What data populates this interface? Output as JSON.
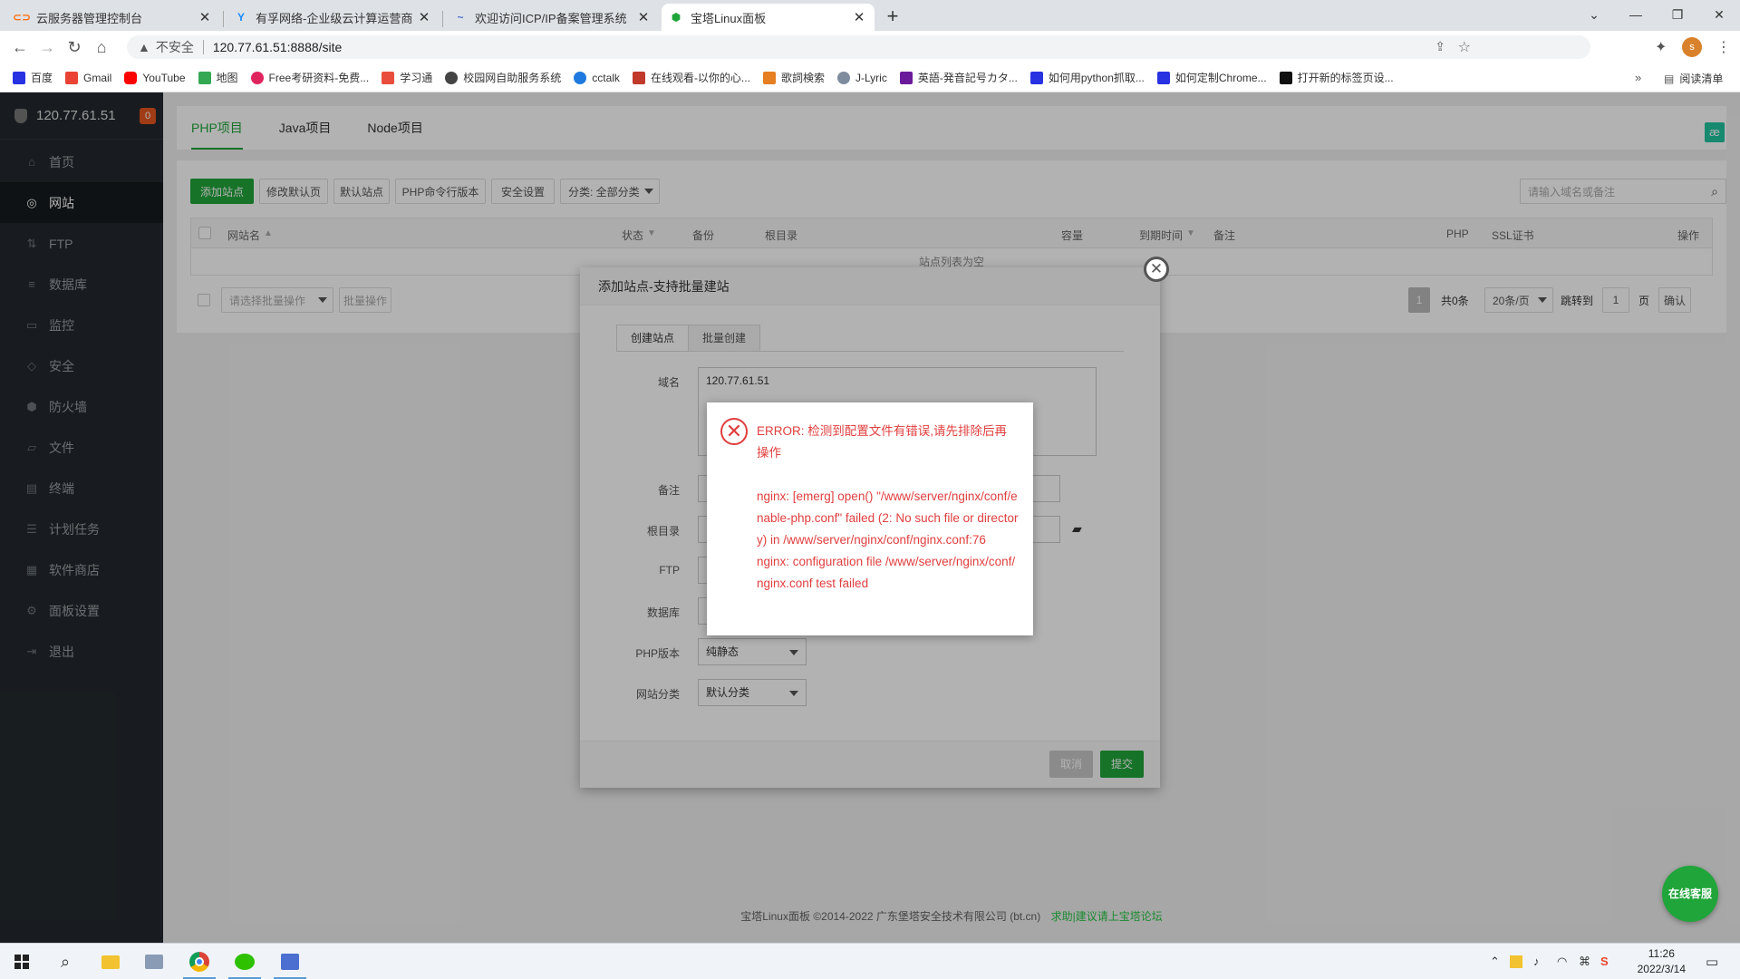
{
  "browser": {
    "tabs": [
      {
        "title": "云服务器管理控制台",
        "icon_color": "#ff6a00"
      },
      {
        "title": "有孚网络-企业级云计算运营商",
        "icon_color": "#1a8cff"
      },
      {
        "title": "欢迎访问ICP/IP备案管理系统",
        "icon_color": "#4a6fd0"
      },
      {
        "title": "宝塔Linux面板",
        "icon_color": "#20a53a"
      }
    ],
    "address": {
      "security": "不安全",
      "url": "120.77.61.51:8888/site"
    },
    "bookmarks": [
      {
        "label": "百度",
        "color": "#2932e1"
      },
      {
        "label": "Gmail",
        "color": "#ea4335"
      },
      {
        "label": "YouTube",
        "color": "#ff0000"
      },
      {
        "label": "地图",
        "color": "#34a853"
      },
      {
        "label": "Free考研资料-免费...",
        "color": "#e0245e"
      },
      {
        "label": "学习通",
        "color": "#e94e3c"
      },
      {
        "label": "校园网自助服务系统",
        "color": "#444444"
      },
      {
        "label": "cctalk",
        "color": "#1f7ae0"
      },
      {
        "label": "在线观看-以你的心...",
        "color": "#c0392b"
      },
      {
        "label": "歌詞検索",
        "color": "#e67e22"
      },
      {
        "label": "J-Lyric",
        "color": "#7f8c9d"
      },
      {
        "label": "英語-発音記号カタ...",
        "color": "#6a1b9a"
      },
      {
        "label": "如何用python抓取...",
        "color": "#2932e1"
      },
      {
        "label": "如何定制Chrome...",
        "color": "#2932e1"
      },
      {
        "label": "打开新的标签页设...",
        "color": "#111111"
      }
    ],
    "reading_list": "阅读清单"
  },
  "sidebar": {
    "host": "120.77.61.51",
    "badge": "0",
    "items": [
      {
        "label": "首页",
        "icon": "⌂"
      },
      {
        "label": "网站",
        "icon": "◎"
      },
      {
        "label": "FTP",
        "icon": "⇅"
      },
      {
        "label": "数据库",
        "icon": "≡"
      },
      {
        "label": "监控",
        "icon": "▭"
      },
      {
        "label": "安全",
        "icon": "◇"
      },
      {
        "label": "防火墙",
        "icon": "⬢"
      },
      {
        "label": "文件",
        "icon": "▱"
      },
      {
        "label": "终端",
        "icon": "▤"
      },
      {
        "label": "计划任务",
        "icon": "☰"
      },
      {
        "label": "软件商店",
        "icon": "▦"
      },
      {
        "label": "面板设置",
        "icon": "⚙"
      },
      {
        "label": "退出",
        "icon": "⇥"
      }
    ]
  },
  "main": {
    "project_tabs": [
      "PHP项目",
      "Java项目",
      "Node项目"
    ],
    "toolbar": {
      "add_site": "添加站点",
      "modify_default": "修改默认页",
      "default_site": "默认站点",
      "php_cli": "PHP命令行版本",
      "security": "安全设置",
      "category": "分类: 全部分类"
    },
    "search_placeholder": "请输入域名或备注",
    "table_headers": [
      "网站名",
      "状态",
      "备份",
      "根目录",
      "容量",
      "到期时间",
      "备注",
      "PHP",
      "SSL证书",
      "操作"
    ],
    "empty_text": "站点列表为空",
    "batch_select": "请选择批量操作",
    "batch_button": "批量操作",
    "pagination": {
      "current": "1",
      "total": "共0条",
      "per_page": "20条/页",
      "jump": "跳转到",
      "jump_value": "1",
      "page_unit": "页",
      "confirm": "确认"
    },
    "footer": {
      "copyright": "宝塔Linux面板 ©2014-2022 广东堡塔安全技术有限公司 (bt.cn)",
      "link": "求助|建议请上宝塔论坛"
    },
    "kefu": "在线客服"
  },
  "dialog": {
    "title": "添加站点-支持批量建站",
    "tabs": [
      "创建站点",
      "批量创建"
    ],
    "fields": {
      "domain_label": "域名",
      "domain_value": "120.77.61.51",
      "remark_label": "备注",
      "root_label": "根目录",
      "ftp_label": "FTP",
      "db_label": "数据库",
      "php_label": "PHP版本",
      "php_value": "纯静态",
      "category_label": "网站分类",
      "category_value": "默认分类"
    },
    "cancel": "取消",
    "submit": "提交"
  },
  "error": {
    "heading": "ERROR: 检测到配置文件有错误,请先排除后再操作",
    "line1": "nginx: [emerg] open() \"/www/server/nginx/conf/enable-php.conf\" failed (2: No such file or directory) in /www/server/nginx/conf/nginx.conf:76",
    "line2": "nginx: configuration file /www/server/nginx/conf/nginx.conf test failed"
  },
  "taskbar": {
    "time": "11:26",
    "date": "2022/3/14"
  }
}
